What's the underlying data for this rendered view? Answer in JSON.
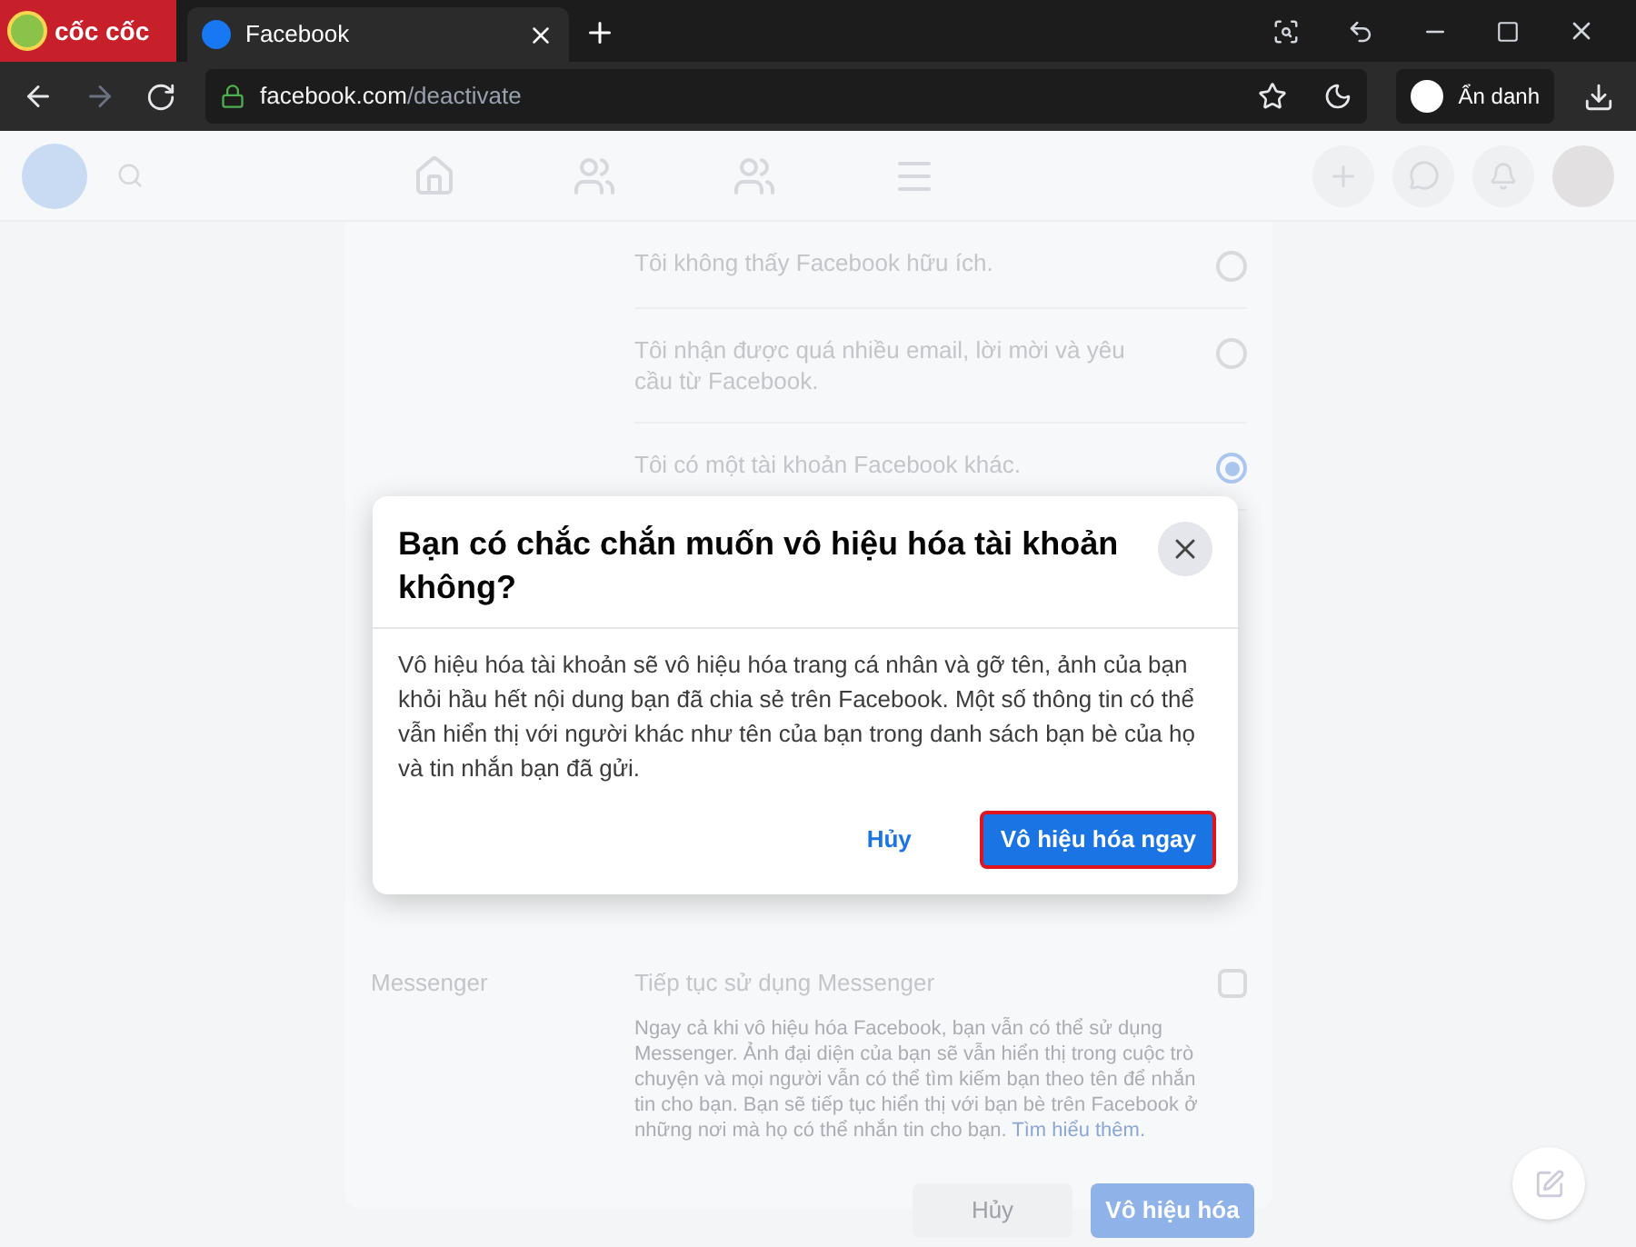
{
  "browser": {
    "brand": "cốc cốc",
    "tab": {
      "title": "Facebook",
      "selected": true
    },
    "url": {
      "domain": "facebook.com",
      "path": "/deactivate"
    },
    "incognito": "Ẩn danh"
  },
  "reasons": [
    {
      "label": "Tôi không thấy Facebook hữu ích.",
      "selected": false
    },
    {
      "label": "Tôi nhận được quá nhiều email, lời mời và yêu cầu từ Facebook.",
      "selected": false
    },
    {
      "label": "Tôi có một tài khoản Facebook khác.",
      "selected": true
    }
  ],
  "messenger": {
    "section": "Messenger",
    "option": "Tiếp tục sử dụng Messenger",
    "checked": false,
    "description": "Ngay cả khi vô hiệu hóa Facebook, bạn vẫn có thể sử dụng Messenger. Ảnh đại diện của bạn sẽ vẫn hiển thị trong cuộc trò chuyện và mọi người vẫn có thể tìm kiếm bạn theo tên để nhắn tin cho bạn. Bạn sẽ tiếp tục hiển thị với bạn bè trên Facebook ở những nơi mà họ có thể nhắn tin cho bạn.",
    "link": "Tìm hiểu thêm."
  },
  "page_buttons": {
    "cancel": "Hủy",
    "deactivate": "Vô hiệu hóa"
  },
  "dialog": {
    "title": "Bạn có chắc chắn muốn vô hiệu hóa tài khoản không?",
    "body": "Vô hiệu hóa tài khoản sẽ vô hiệu hóa trang cá nhân và gỡ tên, ảnh của bạn khỏi hầu hết nội dung bạn đã chia sẻ trên Facebook. Một số thông tin có thể vẫn hiển thị với người khác như tên của bạn trong danh sách bạn bè của họ và tin nhắn bạn đã gửi.",
    "cancel": "Hủy",
    "confirm": "Vô hiệu hóa ngay"
  }
}
